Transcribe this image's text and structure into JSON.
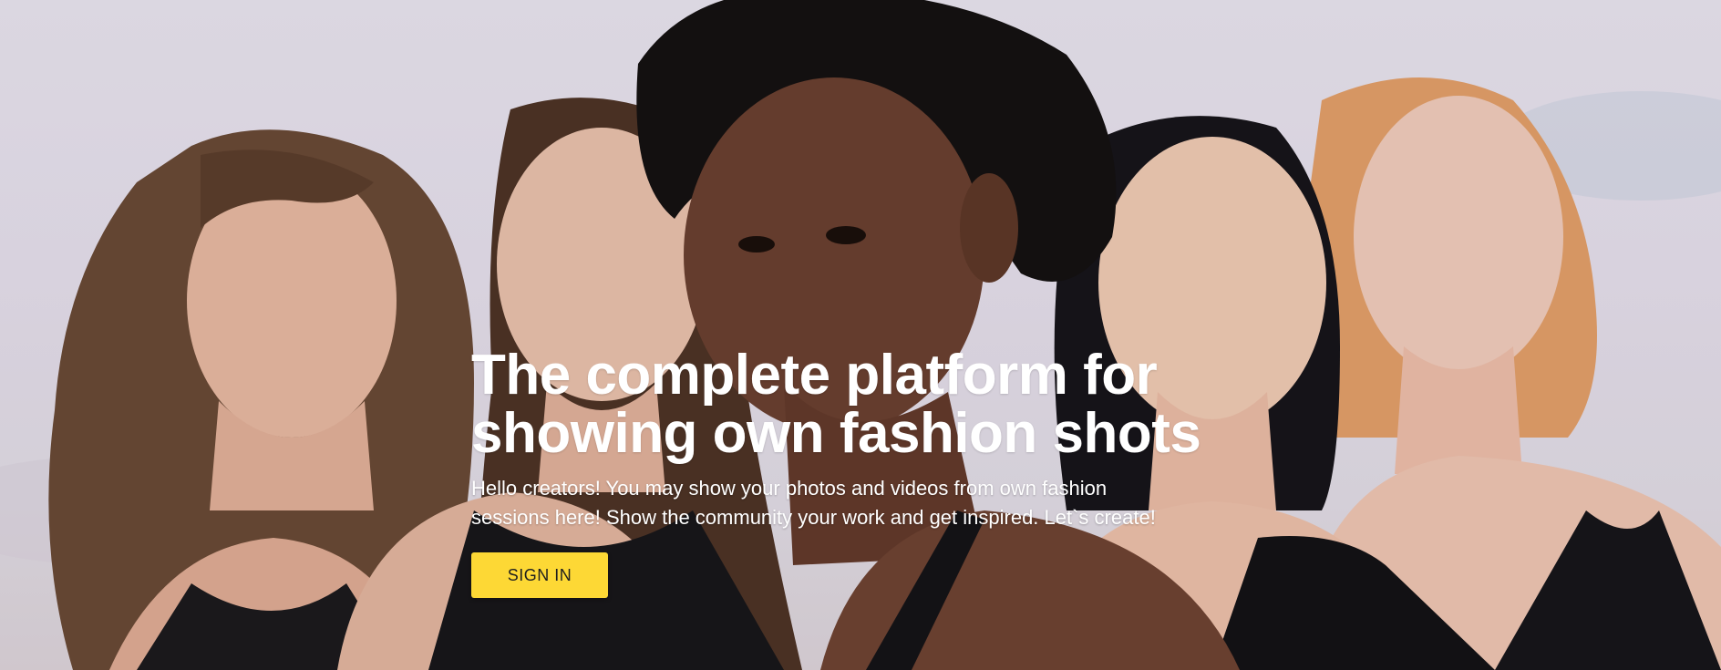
{
  "hero": {
    "headline_line1": "The complete platform for",
    "headline_line2": "showing own fashion shots",
    "subtext_line1": "Hello creators! You may show your photos and videos from own fashion",
    "subtext_line2": "sessions here! Show the community your work and get inspired. Let`s create!",
    "signin_label": "SIGN IN"
  },
  "colors": {
    "button_background": "#fdd835",
    "button_text": "#1f1f1f",
    "headline_text": "#ffffff",
    "sky": "#e7e2ee"
  },
  "background_image": "group-of-five-women-portrait"
}
